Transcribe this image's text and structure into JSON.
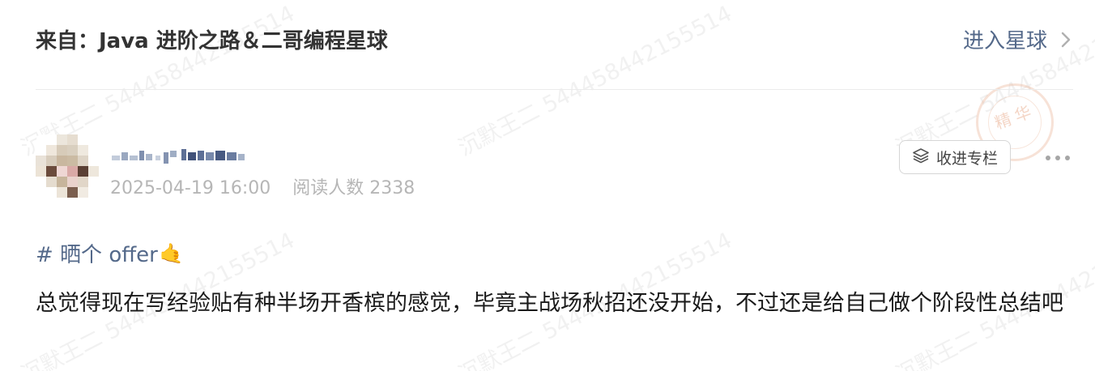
{
  "source": {
    "text": "来自：Java 进阶之路＆二哥编程星球",
    "enter_label": "进入星球"
  },
  "author": {
    "timestamp": "2025-04-19 16:00",
    "reads": "阅读人数 2338"
  },
  "actions": {
    "collect_label": "收进专栏"
  },
  "post": {
    "hashtag": "# 晒个 offer",
    "hashtag_emoji": "🤙",
    "body": "总觉得现在写经验贴有种半场开香槟的感觉，毕竟主战场秋招还没开始，不过还是给自己做个阶段性总结吧"
  },
  "watermark": {
    "text": "沉默王二 544458442155514",
    "seal_text": "精华"
  },
  "colors": {
    "link": "#54698a",
    "meta": "#b6b6b6",
    "seal": "#e8ac8c"
  }
}
